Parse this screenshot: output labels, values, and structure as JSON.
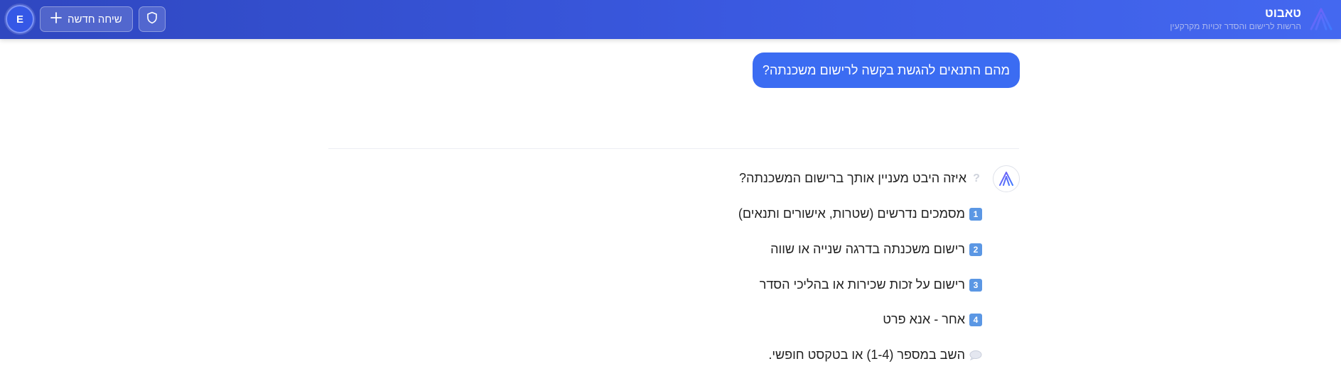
{
  "app": {
    "title": "טאבוט",
    "subtitle": "הרשות לרישום והסדר זכויות מקרקעין"
  },
  "header": {
    "new_chat_label": "שיחה חדשה",
    "avatar_initial": "E"
  },
  "colors": {
    "header_start": "#2f47c0",
    "header_end": "#4468f0",
    "user_bubble": "#3b6cf2",
    "keycap": "#5b97e4"
  },
  "chat": {
    "user_message": "מהם התנאים להגשת בקשה לרישום משכנתה?",
    "bot": {
      "question": "איזה היבט מעניין אותך ברישום המשכנתה?",
      "options": [
        {
          "key": "1",
          "text": "מסמכים נדרשים (שטרות, אישורים ותנאים)"
        },
        {
          "key": "2",
          "text": "רישום משכנתה בדרגה שנייה או שווה"
        },
        {
          "key": "3",
          "text": "רישום על זכות שכירות או בהליכי הסדר"
        },
        {
          "key": "4",
          "text": "אחר - אנא פרט"
        }
      ],
      "prompt": "השב במספר (1-4) או בטקסט חופשי."
    }
  }
}
